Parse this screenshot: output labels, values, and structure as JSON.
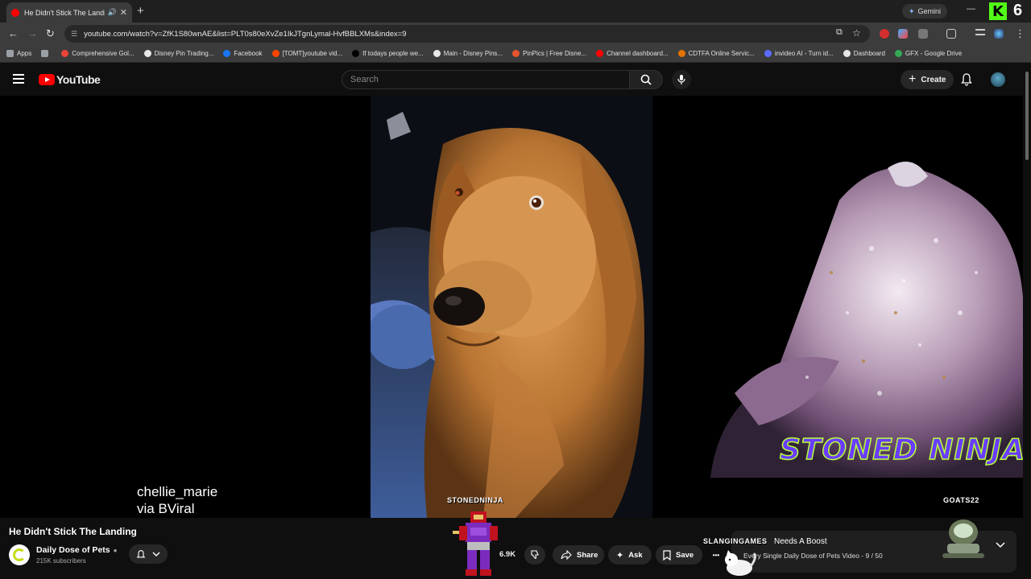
{
  "browser": {
    "tab_title": "He Didn't Stick The Landing",
    "tab_speaker": "🔊",
    "tab_close": "✕",
    "new_tab": "+",
    "gemini_label": "Gemini",
    "k_badge": "K",
    "k_number": "6",
    "url": "youtube.com/watch?v=ZfK1S80wnAE&list=PLT0s80eXvZe1IkJTgnLymal-HvfBBLXMs&index=9",
    "bookmarks": [
      {
        "label": "Apps",
        "color": "#9aa0a6"
      },
      {
        "label": "",
        "color": "#9aa0a6"
      },
      {
        "label": "Comprehensive Gol...",
        "color": "#ea4335"
      },
      {
        "label": "Disney Pin Trading...",
        "color": "#e8e8e8"
      },
      {
        "label": "Facebook",
        "color": "#1877f2"
      },
      {
        "label": "[TOMT]youtube vid...",
        "color": "#ff4500"
      },
      {
        "label": "If todays people we...",
        "color": "#000000"
      },
      {
        "label": "Main - Disney Pins...",
        "color": "#e8e8e8"
      },
      {
        "label": "PinPics | Free Disne...",
        "color": "#e8542e"
      },
      {
        "label": "Channel dashboard...",
        "color": "#ff0000"
      },
      {
        "label": "CDTFA Online Servic...",
        "color": "#e37400"
      },
      {
        "label": "invideo AI - Turn id...",
        "color": "#5b6cff"
      },
      {
        "label": "Dashboard",
        "color": "#e8e8e8"
      },
      {
        "label": "GFX - Google Drive",
        "color": "#34a853"
      }
    ]
  },
  "youtube": {
    "logo_text": "YouTube",
    "search_placeholder": "Search",
    "create_label": "Create"
  },
  "video": {
    "credit_line1": "chellie_marie",
    "credit_line2": "via BViral",
    "watermark_left": "STONEDNINJA",
    "watermark_right": "GOATS22",
    "stoned_text": "STONED NINJA",
    "slanging_text": "SLANGINGAMES"
  },
  "info": {
    "title": "He Didn't Stick The Landing",
    "channel_name": "Daily Dose of Pets",
    "verified": "●",
    "subscribers": "215K subscribers",
    "like_count": "6.9K",
    "share_label": "Share",
    "ask_label": "Ask",
    "save_label": "Save",
    "more_label": "•••",
    "playlist_title": "Needs A Boost",
    "playlist_sub": "Every Single Daily Dose of Pets Video - 9 / 50"
  },
  "colors": {
    "youtube_red": "#ff0000",
    "kick_green": "#53fc18",
    "stoned_purple": "#6a3cff",
    "stoned_outline": "#b9ff3a"
  },
  "icons": [
    "speaker-icon",
    "gemini-star-icon",
    "back-icon",
    "forward-icon",
    "reload-icon",
    "site-info-icon",
    "bookmark-star-icon",
    "hamburger-icon",
    "search-icon",
    "mic-icon",
    "bell-icon",
    "bell-sub-icon",
    "chevron-down-icon",
    "dislike-icon",
    "share-icon",
    "ask-sparkle-icon",
    "save-icon",
    "more-icon"
  ]
}
